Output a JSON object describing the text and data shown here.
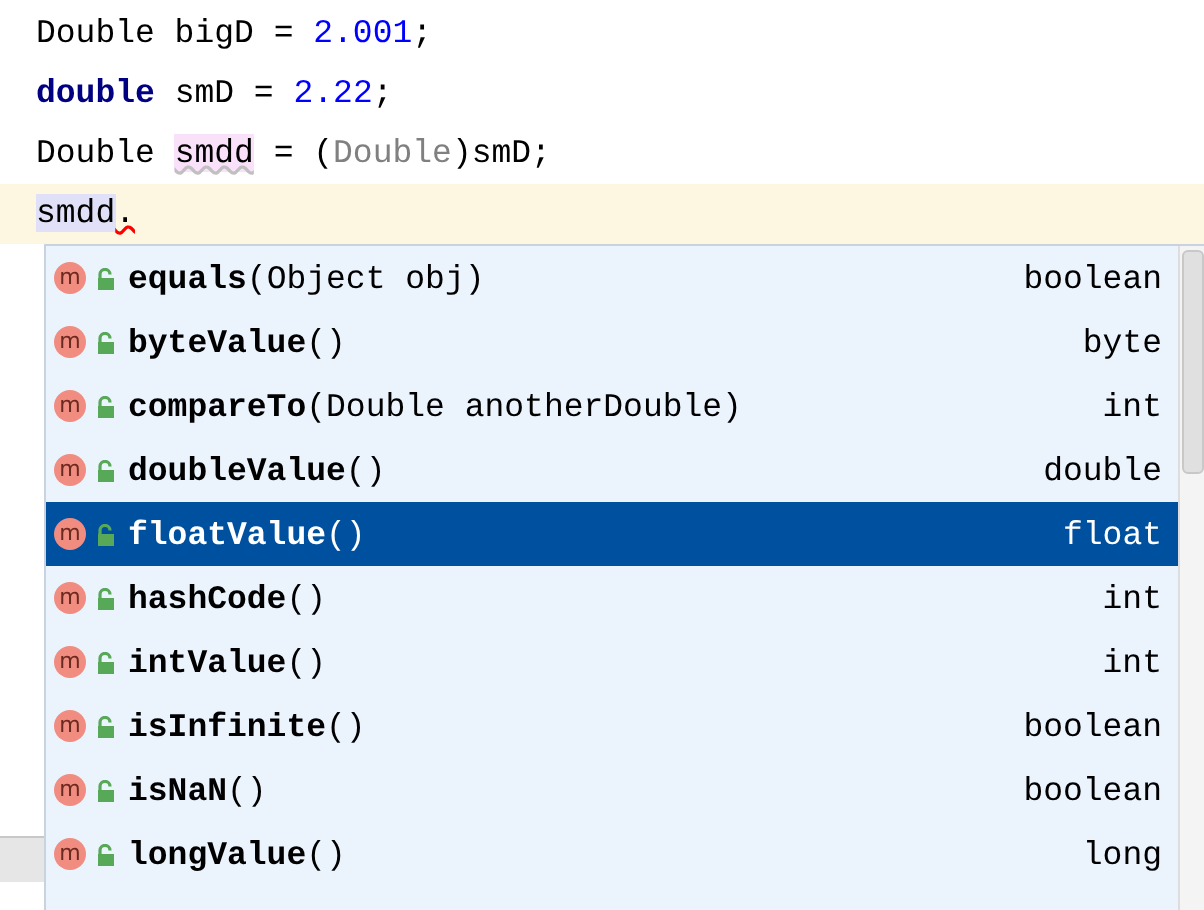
{
  "code_lines": [
    {
      "current": false,
      "tokens": [
        {
          "text": "Double bigD = ",
          "kind": "plain"
        },
        {
          "text": "2.001",
          "kind": "number"
        },
        {
          "text": ";",
          "kind": "plain"
        }
      ]
    },
    {
      "current": false,
      "tokens": [
        {
          "text": "double",
          "kind": "keyword"
        },
        {
          "text": " smD = ",
          "kind": "plain"
        },
        {
          "text": "2.22",
          "kind": "number"
        },
        {
          "text": ";",
          "kind": "plain"
        }
      ]
    },
    {
      "current": false,
      "tokens": [
        {
          "text": "Double ",
          "kind": "plain"
        },
        {
          "text": "smdd",
          "kind": "declaration"
        },
        {
          "text": " = (",
          "kind": "plain"
        },
        {
          "text": "Double",
          "kind": "redundant"
        },
        {
          "text": ")smD;",
          "kind": "plain"
        }
      ]
    },
    {
      "current": true,
      "tokens": [
        {
          "text": "smdd",
          "kind": "usage"
        },
        {
          "text": ".",
          "kind": "error"
        }
      ]
    }
  ],
  "completion": {
    "items": [
      {
        "icon_letter": "m",
        "name": "equals",
        "params": "(Object obj)",
        "type": "boolean",
        "selected": false
      },
      {
        "icon_letter": "m",
        "name": "byteValue",
        "params": "()",
        "type": "byte",
        "selected": false
      },
      {
        "icon_letter": "m",
        "name": "compareTo",
        "params": "(Double anotherDouble)",
        "type": "int",
        "selected": false
      },
      {
        "icon_letter": "m",
        "name": "doubleValue",
        "params": "()",
        "type": "double",
        "selected": false
      },
      {
        "icon_letter": "m",
        "name": "floatValue",
        "params": "()",
        "type": "float",
        "selected": true
      },
      {
        "icon_letter": "m",
        "name": "hashCode",
        "params": "()",
        "type": "int",
        "selected": false
      },
      {
        "icon_letter": "m",
        "name": "intValue",
        "params": "()",
        "type": "int",
        "selected": false
      },
      {
        "icon_letter": "m",
        "name": "isInfinite",
        "params": "()",
        "type": "boolean",
        "selected": false
      },
      {
        "icon_letter": "m",
        "name": "isNaN",
        "params": "()",
        "type": "boolean",
        "selected": false
      },
      {
        "icon_letter": "m",
        "name": "longValue",
        "params": "()",
        "type": "long",
        "selected": false
      }
    ]
  }
}
